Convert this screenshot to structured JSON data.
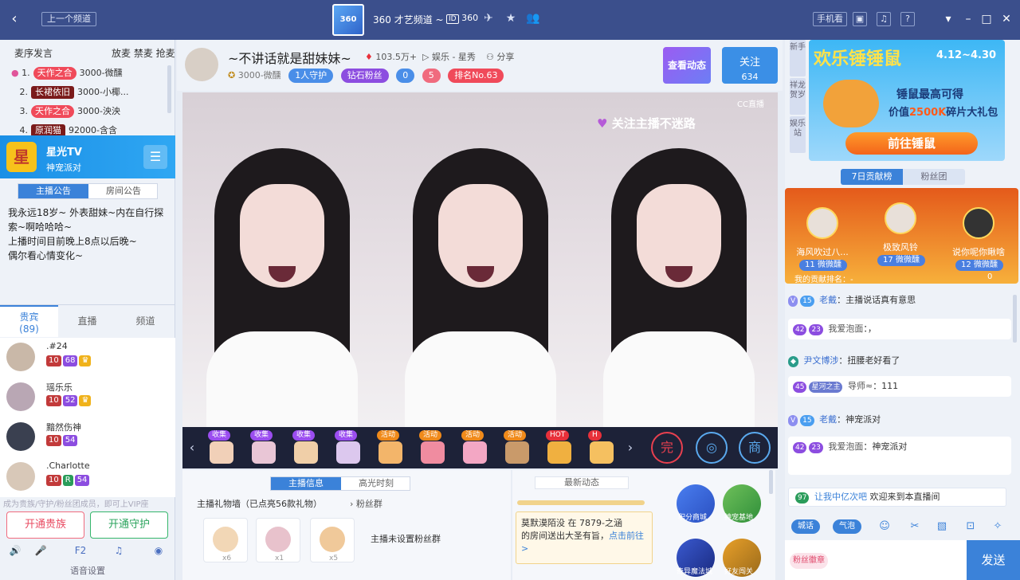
{
  "topbar": {
    "back_icon": "chevron-left-icon",
    "prev_channel": "上一个频道",
    "logo_text": "360",
    "channel_title": "360 才艺频道 ~",
    "channel_id_prefix": "ID",
    "channel_id": "360",
    "phone_label": "手机看",
    "icons": [
      "rocket-icon",
      "star-icon",
      "users-icon"
    ]
  },
  "mic_queue": {
    "order_label": "麦序发言",
    "actions": "放麦 禁麦 抢麦",
    "rows": [
      {
        "num": "1.",
        "tag": "天作之合",
        "name": "3000-微醺"
      },
      {
        "num": "2.",
        "tag": "长裙依旧",
        "name": "3000-小椰..."
      },
      {
        "num": "3.",
        "tag": "天作之合",
        "name": "3000-泱泱"
      },
      {
        "num": "4.",
        "tag": "原润猫",
        "name": "92000-含含"
      }
    ]
  },
  "star_tv": {
    "logo": "星",
    "name": "星光TV",
    "subtitle": "神宠派对"
  },
  "notice": {
    "tab_anchor": "主播公告",
    "tab_room": "房间公告",
    "lines": [
      "我永远18岁~ 外表甜妹~内在自行探索~啊哈哈哈~",
      "上播时间目前晚上8点以后晚~",
      "偶尔看心情变化~"
    ]
  },
  "fans": {
    "tab_noble": "贵宾",
    "tab_noble_count": "(89)",
    "tab_live": "直播",
    "tab_channel": "频道",
    "items": [
      {
        "name": ".#24",
        "level": "68"
      },
      {
        "name": "瑶乐乐",
        "level": "52"
      },
      {
        "name": "黯然伤神",
        "level": "54"
      },
      {
        "name": ".Charlotte",
        "level": "54"
      }
    ],
    "hint": "成为贵族/守护/粉丝团成员，即可上VIP座",
    "btn_noble": "开通贵族",
    "btn_guard": "开通守护",
    "voice_settings": "语音设置"
  },
  "anchor": {
    "name": "~不讲话就是甜妹妹~",
    "heat": "103.5万+",
    "category": "娱乐 - 星秀",
    "share": "分享",
    "sub_name": "3000-微醺",
    "guard": "1人守护",
    "diamond": "钻石粉丝",
    "fans_count": "0",
    "star_level": "5",
    "rank": "排名No.63",
    "btn_dynamic": "查看动态",
    "btn_follow": "关注",
    "follow_count": "634"
  },
  "video": {
    "badge": "关注主播不迷路",
    "watermark": "CC直播"
  },
  "gift_bar": {
    "gifts": [
      {
        "tag": "收集",
        "color": "#9b4df0"
      },
      {
        "tag": "收集",
        "color": "#9b4df0"
      },
      {
        "tag": "收集",
        "color": "#9b4df0"
      },
      {
        "tag": "收集",
        "color": "#9b4df0"
      },
      {
        "tag": "活动",
        "color": "#f08a1a"
      },
      {
        "tag": "活动",
        "color": "#f08a1a"
      },
      {
        "tag": "活动",
        "color": "#f08a1a"
      },
      {
        "tag": "活动",
        "color": "#f08a1a"
      },
      {
        "tag": "HOT",
        "color": "#e8303a"
      },
      {
        "tag": "H",
        "color": "#e8303a"
      }
    ],
    "tools": [
      "complete-icon",
      "bag-icon",
      "shop-icon"
    ]
  },
  "info": {
    "tab_info": "主播信息",
    "tab_highlight": "高光时刻",
    "gift_wall": "主播礼物墙（已点亮56款礼物）",
    "fan_group": "粉丝群",
    "gift_counts": [
      "x6",
      "x1",
      "x5"
    ],
    "no_fan_group": "主播未设置粉丝群"
  },
  "news": {
    "title": "最新动态",
    "card_user": "莫默漠陌没",
    "card_mid": "在",
    "card_room": "7879-之涵",
    "card_text": "的房间送出大圣有旨，",
    "card_link": "点击前往>"
  },
  "apps": {
    "points_mall": "积分商城",
    "god_pet": "神宠基地",
    "magic": "奇异魔法城",
    "friends": "好友闯关"
  },
  "right_side_tabs": [
    "新手",
    "祥龙贺岁",
    "娱乐站"
  ],
  "banner": {
    "title": "欢乐锤锤鼠",
    "date": "4.12~4.30",
    "line1": "锤鼠最高可得",
    "line2_pre": "价值",
    "line2_hl": "2500K",
    "line2_post": "碎片大礼包",
    "button": "前往锤鼠"
  },
  "rank": {
    "tab_week": "7日贡献榜",
    "tab_fans": "粉丝团",
    "top": [
      {
        "name": "海风吹过八...",
        "lv": "11",
        "badge": "微微醺"
      },
      {
        "name": "极致风铃",
        "lv": "17",
        "badge": "微微醺"
      },
      {
        "name": "说你呢你瞅啥",
        "lv": "12",
        "badge": "微微醺"
      }
    ],
    "my_rank": "我的贡献排名：-",
    "my_value": "0"
  },
  "chat": {
    "messages": [
      {
        "lv": "15",
        "name": "老戴",
        "text": "：主播说话真有意思"
      },
      {
        "lv": "23",
        "name": "我爱泡面",
        "text": "：，"
      },
      {
        "lv": "",
        "name": "尹文博涉",
        "text": "：扭腰老好看了"
      },
      {
        "lv": "45",
        "name": "导师≈",
        "text": "：111"
      },
      {
        "lv": "15",
        "name": "老戴",
        "text": "：神宠派对"
      },
      {
        "lv": "23",
        "name": "我爱泡面",
        "text": "：神宠派对"
      }
    ],
    "welcome_hl": "让我中亿次吧",
    "welcome_text": "欢迎来到本直播间",
    "btn_city": "城话",
    "btn_bubble": "气泡",
    "fan_badge": "粉丝徽章",
    "send": "发送"
  }
}
